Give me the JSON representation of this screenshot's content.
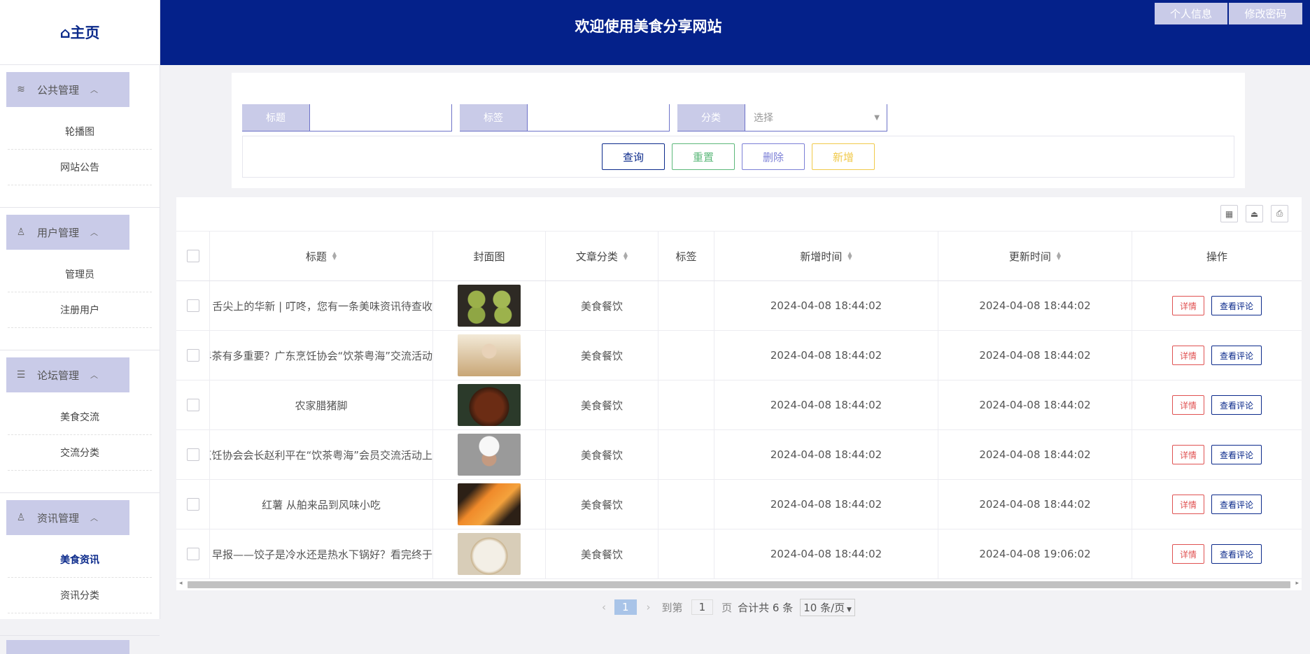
{
  "sidebar": {
    "home": "⌂主页",
    "groups": [
      {
        "title": "公共管理",
        "icon": "layers-icon",
        "items": [
          {
            "label": "轮播图"
          },
          {
            "label": "网站公告"
          }
        ]
      },
      {
        "title": "用户管理",
        "icon": "user-icon",
        "items": [
          {
            "label": "管理员"
          },
          {
            "label": "注册用户"
          }
        ]
      },
      {
        "title": "论坛管理",
        "icon": "forum-icon",
        "items": [
          {
            "label": "美食交流"
          },
          {
            "label": "交流分类"
          }
        ]
      },
      {
        "title": "资讯管理",
        "icon": "news-icon",
        "items": [
          {
            "label": "美食资讯",
            "active": true
          },
          {
            "label": "资讯分类"
          }
        ]
      }
    ]
  },
  "header": {
    "title": "欢迎使用美食分享网站",
    "profile": "个人信息",
    "password": "修改密码"
  },
  "search": {
    "title_label": "标题",
    "tag_label": "标签",
    "category_label": "分类",
    "category_placeholder": "选择",
    "query": "查询",
    "reset": "重置",
    "delete": "删除",
    "add": "新增"
  },
  "table": {
    "columns": [
      "标题",
      "封面图",
      "文章分类",
      "标签",
      "新增时间",
      "更新时间",
      "操作"
    ],
    "detail": "详情",
    "comments": "查看评论",
    "rows": [
      {
        "title": "舌尖上的华新 | 叮咚，您有一条美味资讯待查收",
        "category": "美食餐饮",
        "tag": "",
        "created": "2024-04-08 18:44:02",
        "updated": "2024-04-08 18:44:02"
      },
      {
        "title": "早茶有多重要？广东烹饪协会“饮茶粤海”交流活动",
        "category": "美食餐饮",
        "tag": "",
        "created": "2024-04-08 18:44:02",
        "updated": "2024-04-08 18:44:02"
      },
      {
        "title": "农家腊猪脚",
        "category": "美食餐饮",
        "tag": "",
        "created": "2024-04-08 18:44:02",
        "updated": "2024-04-08 18:44:02"
      },
      {
        "title": "烹饪协会会长赵利平在“饮茶粤海”会员交流活动上",
        "category": "美食餐饮",
        "tag": "",
        "created": "2024-04-08 18:44:02",
        "updated": "2024-04-08 18:44:02"
      },
      {
        "title": "红薯 从舶来品到风味小吃",
        "category": "美食餐饮",
        "tag": "",
        "created": "2024-04-08 18:44:02",
        "updated": "2024-04-08 18:44:02"
      },
      {
        "title": "早报——饺子是冷水还是热水下锅好？看完终于",
        "category": "美食餐饮",
        "tag": "",
        "created": "2024-04-08 18:44:02",
        "updated": "2024-04-08 19:06:02"
      }
    ]
  },
  "pager": {
    "prev": "‹",
    "current": "1",
    "next": "›",
    "goto": "到第",
    "page_input": "1",
    "page_unit": "页",
    "total": "合计共 6 条",
    "size": "10 条/页"
  }
}
